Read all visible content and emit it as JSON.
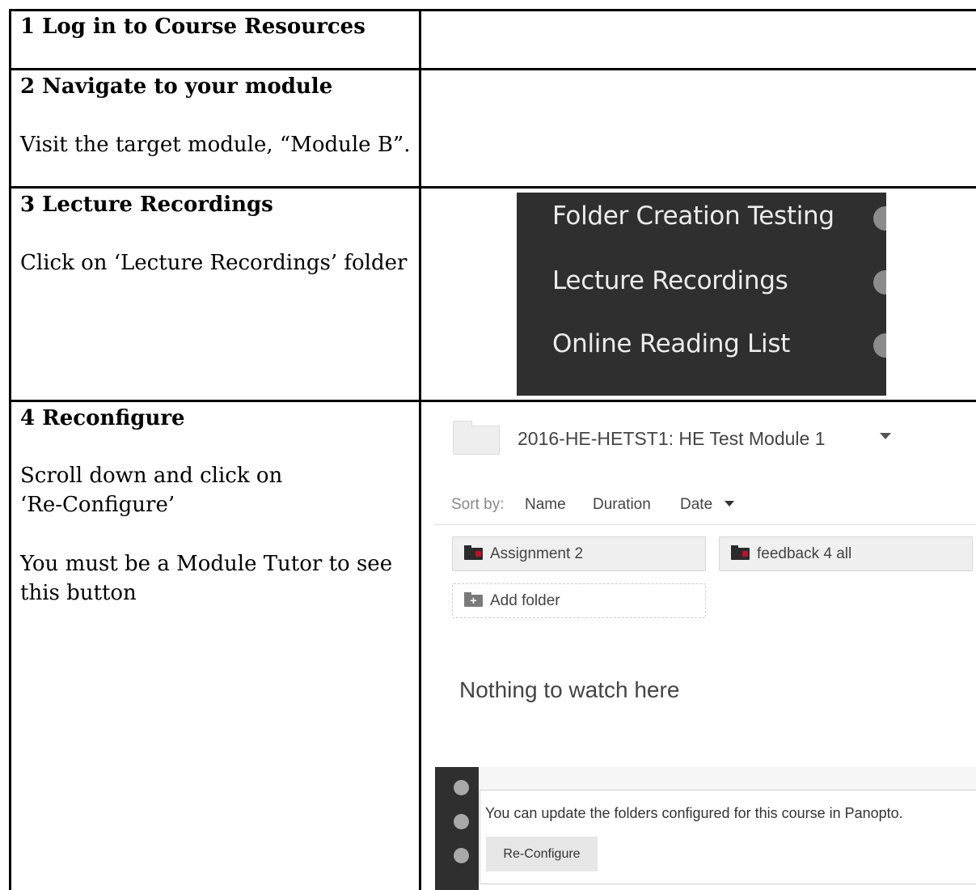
{
  "rows": [
    {
      "step": "1 Log in to Course Resources"
    },
    {
      "step": "2 Navigate to your module",
      "instructions": [
        "Visit the target module, “Module B”."
      ]
    },
    {
      "step": "3 Lecture Recordings",
      "instructions": [
        "Click on ‘Lecture Recordings’ folder"
      ]
    },
    {
      "step": "4 Reconfigure",
      "instructions": [
        "Scroll down and click on",
        "‘Re-Configure’",
        "You must be a Module Tutor to see",
        "this button"
      ]
    }
  ],
  "menu_screenshot": {
    "items": [
      "Folder Creation Testing",
      "Lecture Recordings",
      "Online Reading List"
    ]
  },
  "panopto_screenshot": {
    "module_title": "2016-HE-HETST1: HE Test Module 1",
    "sort": {
      "label": "Sort by:",
      "options": [
        "Name",
        "Duration",
        "Date"
      ]
    },
    "folders": [
      "Assignment 2",
      "feedback 4 all"
    ],
    "add_folder_label": "Add folder",
    "empty_message": "Nothing to watch here",
    "update_message": "You can update the folders configured for this course in Panopto.",
    "reconfigure_label": "Re-Configure"
  }
}
